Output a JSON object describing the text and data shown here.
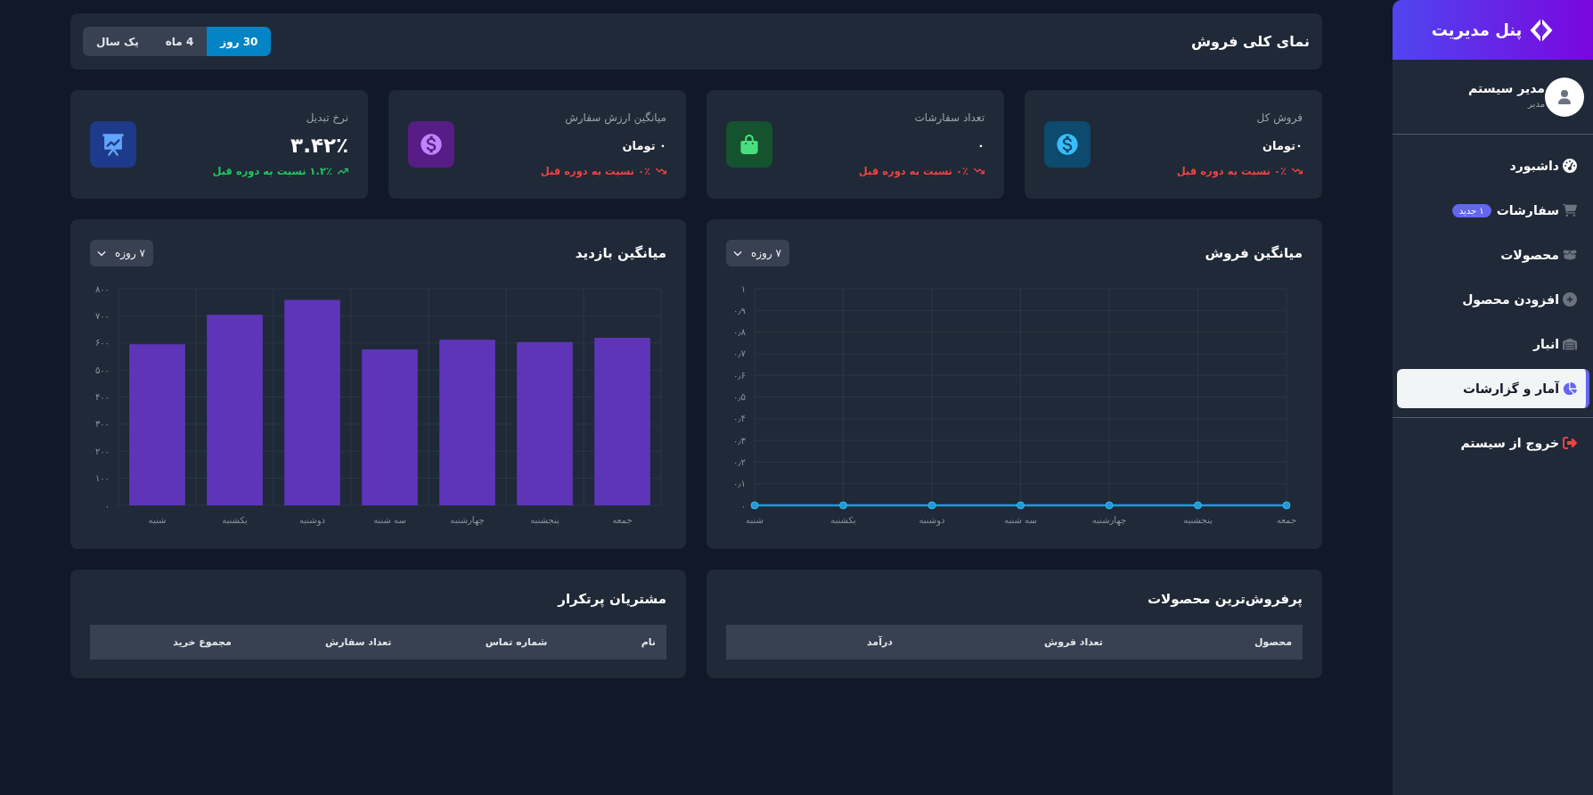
{
  "sidebar": {
    "title": "پنل مدیریت",
    "user": {
      "name": "مدیر سیستم",
      "role": "مدیر"
    },
    "items": [
      {
        "label": "داشبورد",
        "selected": false
      },
      {
        "label": "سفارشات",
        "selected": false,
        "badge": "۱ جدید"
      },
      {
        "label": "محصولات",
        "selected": false
      },
      {
        "label": "افزودن محصول",
        "selected": false
      },
      {
        "label": "انبار",
        "selected": false
      },
      {
        "label": "آمار و گزارشات",
        "selected": true
      }
    ],
    "logout": {
      "label": "خروج از سیستم"
    }
  },
  "overview": {
    "title": "نمای کلی فروش",
    "periods": [
      {
        "label": "30 روز",
        "selected": true
      },
      {
        "label": "4 ماه",
        "selected": false
      },
      {
        "label": "یک سال",
        "selected": false
      }
    ]
  },
  "stats": [
    {
      "label": "فروش کل",
      "value": "۰تومان",
      "kind": "amount",
      "rising": false,
      "change": "۰٪ نسبت به دوره قبل"
    },
    {
      "label": "تعداد سفارشات",
      "value": "۰",
      "kind": "amount",
      "rising": false,
      "change": "۰٪ نسبت به دوره قبل"
    },
    {
      "label": "میانگین ارزش سفارش",
      "value": "۰ تومان",
      "kind": "amount",
      "rising": false,
      "change": "۰٪ نسبت به دوره قبل"
    },
    {
      "label": "نرخ تبدیل",
      "value": "۳.۴۲٪",
      "kind": "rate",
      "rising": true,
      "change": "۱.۲٪ نسبت به دوره قبل"
    }
  ],
  "charts": [
    {
      "title": "میانگین فروش",
      "period": "۷ روزه",
      "chart_data": {
        "type": "line",
        "grid": true,
        "categories": [
          "شنبه",
          "یکشنبه",
          "دوشنبه",
          "سه شنبه",
          "چهارشنبه",
          "پنجشنبه",
          "جمعه"
        ],
        "series": [
          {
            "color": "#1e9bd7",
            "marker": "circle",
            "values": [
              0,
              0,
              0,
              0,
              0,
              0,
              0
            ]
          }
        ],
        "ylim": [
          0,
          1
        ],
        "yticks": [
          {
            "value": 0,
            "label": "۰"
          },
          {
            "value": 0.1,
            "label": "۰٫۱"
          },
          {
            "value": 0.2,
            "label": "۰٫۲"
          },
          {
            "value": 0.3,
            "label": "۰٫۳"
          },
          {
            "value": 0.4,
            "label": "۰٫۴"
          },
          {
            "value": 0.5,
            "label": "۰٫۵"
          },
          {
            "value": 0.6,
            "label": "۰٫۶"
          },
          {
            "value": 0.7,
            "label": "۰٫۷"
          },
          {
            "value": 0.8,
            "label": "۰٫۸"
          },
          {
            "value": 0.9,
            "label": "۰٫۹"
          },
          {
            "value": 1,
            "label": "۱"
          }
        ]
      }
    },
    {
      "title": "میانگین بازدید",
      "period": "۷ روزه",
      "chart_data": {
        "type": "bar",
        "grid": true,
        "categories": [
          "شنبه",
          "یکشنبه",
          "دوشنبه",
          "سه شنبه",
          "چهارشنبه",
          "پنجشنبه",
          "جمعه"
        ],
        "series": [
          {
            "color": "#5e35b8",
            "values": [
              595,
              704,
              759,
              576,
              612,
              603,
              619
            ]
          }
        ],
        "ylim": [
          0,
          800
        ],
        "yticks": [
          {
            "value": 0,
            "label": "۰"
          },
          {
            "value": 100,
            "label": "۱۰۰"
          },
          {
            "value": 200,
            "label": "۲۰۰"
          },
          {
            "value": 300,
            "label": "۳۰۰"
          },
          {
            "value": 400,
            "label": "۴۰۰"
          },
          {
            "value": 500,
            "label": "۵۰۰"
          },
          {
            "value": 600,
            "label": "۶۰۰"
          },
          {
            "value": 700,
            "label": "۷۰۰"
          },
          {
            "value": 800,
            "label": "۸۰۰"
          }
        ]
      }
    }
  ],
  "tables": [
    {
      "title": "پرفروش‌ترین محصولات",
      "columns": [
        "محصول",
        "تعداد فروش",
        "درآمد"
      ]
    },
    {
      "title": "مشتریان پرتکرار",
      "columns": [
        "نام",
        "شماره تماس",
        "تعداد سفارش",
        "مجموع خرید"
      ]
    }
  ]
}
